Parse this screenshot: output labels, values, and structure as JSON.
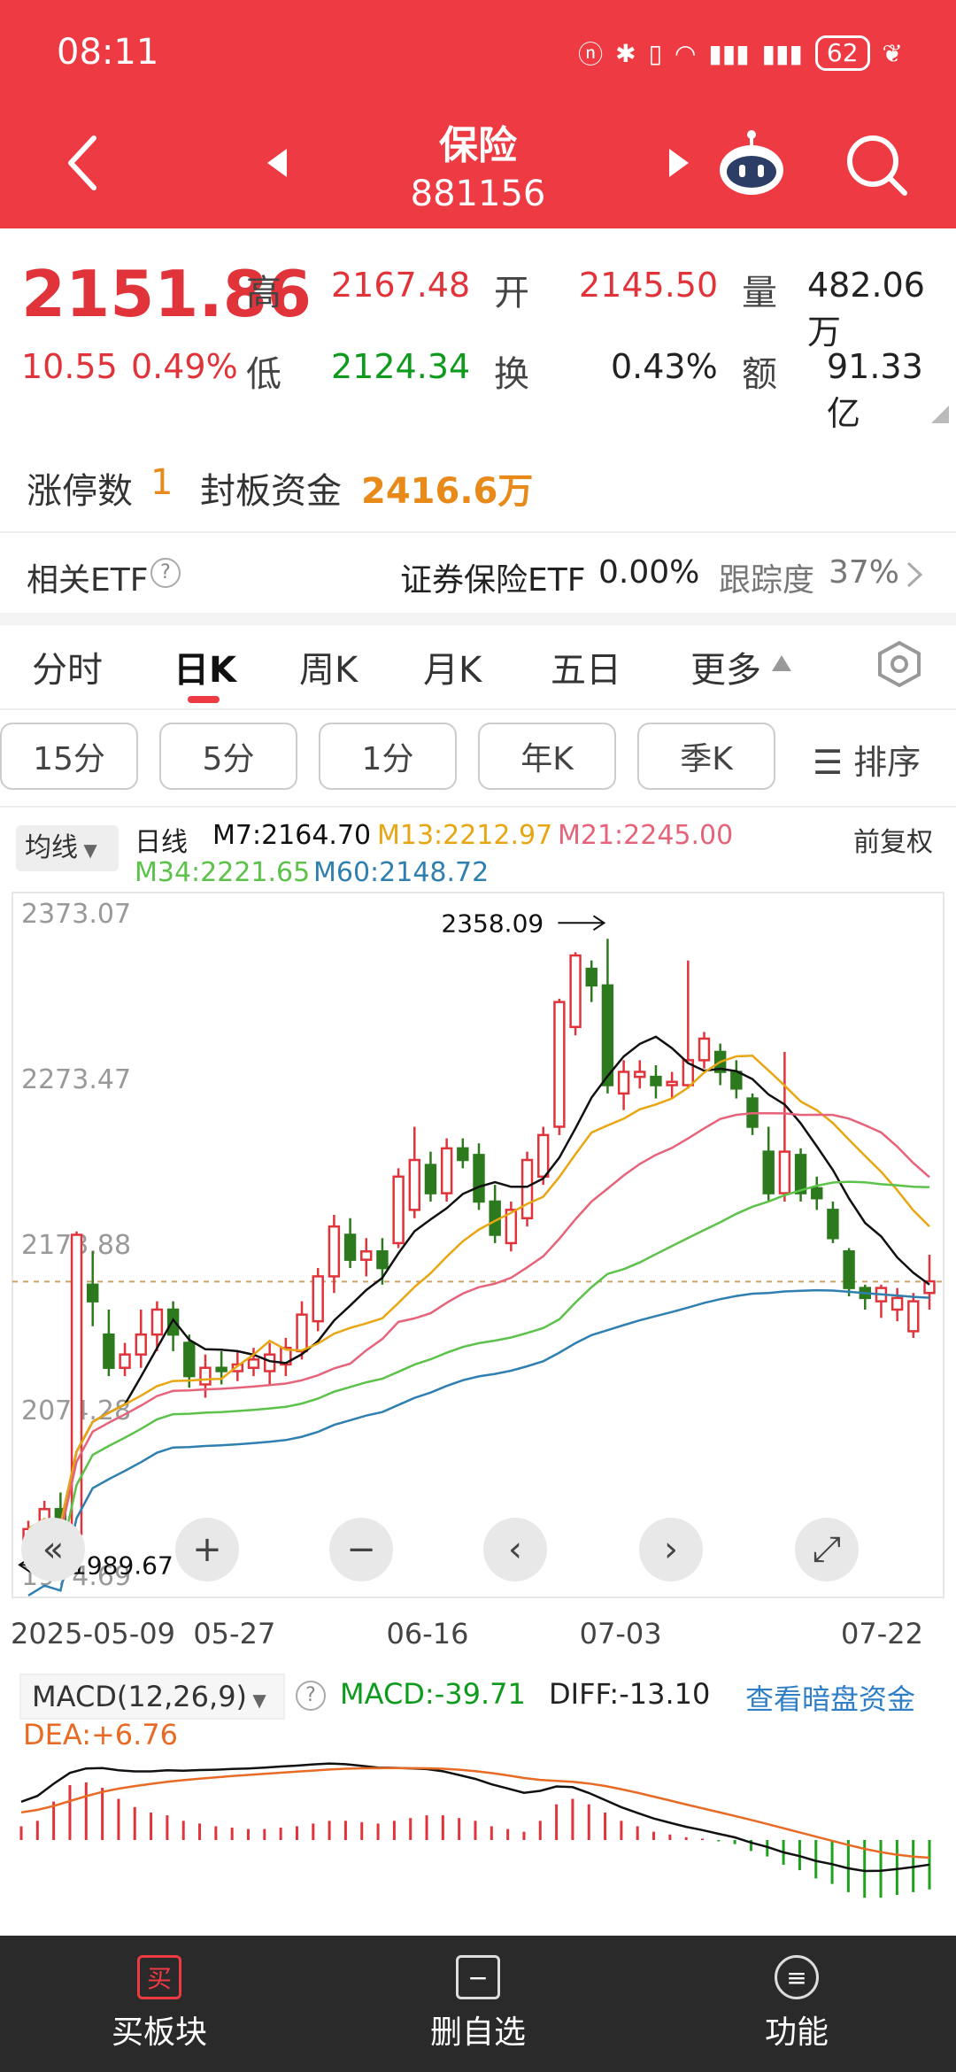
{
  "status": {
    "time": "08:11",
    "battery": "62"
  },
  "header": {
    "title": "保险",
    "code": "881156"
  },
  "quote": {
    "price": "2151.86",
    "change": "10.55",
    "change_pct": "0.49%",
    "high_label": "高",
    "high": "2167.48",
    "open_label": "开",
    "open": "2145.50",
    "vol_label": "量",
    "vol": "482.06万",
    "low_label": "低",
    "low": "2124.34",
    "turnover_label": "换",
    "turnover": "0.43%",
    "amount_label": "额",
    "amount": "91.33亿"
  },
  "limit": {
    "count_label": "涨停数",
    "count": "1",
    "fund_label": "封板资金",
    "fund": "2416.6万"
  },
  "etf": {
    "label": "相关ETF",
    "name": "证券保险ETF",
    "value": "0.00%",
    "track_label": "跟踪度",
    "track": "37%"
  },
  "tabs": [
    "分时",
    "日K",
    "周K",
    "月K",
    "五日",
    "更多"
  ],
  "periods": [
    "15分",
    "5分",
    "1分",
    "年K",
    "季K"
  ],
  "sort_label": "排序",
  "ma_dropdown": "均线",
  "legend": {
    "period": "日线",
    "m7": "M7:2164.70",
    "m13": "M13:2212.97",
    "m21": "M21:2245.00",
    "m34": "M34:2221.65",
    "m60": "M60:2148.72",
    "adjust": "前复权"
  },
  "colors": {
    "accent": "#ee3a42",
    "up": "#e0333a",
    "down": "#2d7a1e",
    "m7": "#111111",
    "m13": "#e8a612",
    "m21": "#e6647a",
    "m34": "#5cc24a",
    "m60": "#2f7fb0"
  },
  "chart_data": {
    "type": "candlestick",
    "y_ticks": [
      "2373.07",
      "2273.47",
      "2173.88",
      "2074.28",
      "1974.69"
    ],
    "ylim": [
      1974.69,
      2373.07
    ],
    "x_ticks": [
      "2025-05-09",
      "05-27",
      "06-16",
      "07-03",
      "07-22"
    ],
    "high_mark": "2358.09",
    "low_mark": "1989.67",
    "candles": [
      [
        1995,
        2003,
        1990,
        2008
      ],
      [
        2003,
        2015,
        1998,
        2020
      ],
      [
        2015,
        2000,
        1995,
        2025
      ],
      [
        2000,
        2180,
        1995,
        2182
      ],
      [
        2150,
        2140,
        2125,
        2170
      ],
      [
        2120,
        2100,
        2095,
        2135
      ],
      [
        2100,
        2108,
        2095,
        2115
      ],
      [
        2108,
        2120,
        2100,
        2135
      ],
      [
        2120,
        2135,
        2110,
        2140
      ],
      [
        2135,
        2120,
        2110,
        2140
      ],
      [
        2115,
        2095,
        2088,
        2120
      ],
      [
        2090,
        2100,
        2082,
        2108
      ],
      [
        2100,
        2098,
        2090,
        2110
      ],
      [
        2098,
        2102,
        2092,
        2110
      ],
      [
        2100,
        2105,
        2095,
        2112
      ],
      [
        2098,
        2108,
        2090,
        2115
      ],
      [
        2102,
        2112,
        2095,
        2118
      ],
      [
        2110,
        2132,
        2105,
        2140
      ],
      [
        2128,
        2155,
        2122,
        2160
      ],
      [
        2155,
        2185,
        2145,
        2192
      ],
      [
        2180,
        2165,
        2160,
        2190
      ],
      [
        2165,
        2170,
        2155,
        2178
      ],
      [
        2170,
        2160,
        2150,
        2178
      ],
      [
        2175,
        2215,
        2172,
        2220
      ],
      [
        2195,
        2225,
        2190,
        2245
      ],
      [
        2222,
        2205,
        2200,
        2230
      ],
      [
        2205,
        2232,
        2200,
        2238
      ],
      [
        2232,
        2225,
        2220,
        2238
      ],
      [
        2228,
        2200,
        2195,
        2235
      ],
      [
        2200,
        2180,
        2175,
        2210
      ],
      [
        2175,
        2195,
        2170,
        2200
      ],
      [
        2190,
        2225,
        2185,
        2230
      ],
      [
        2215,
        2240,
        2210,
        2245
      ],
      [
        2245,
        2320,
        2240,
        2322
      ],
      [
        2305,
        2348,
        2300,
        2350
      ],
      [
        2340,
        2330,
        2320,
        2345
      ],
      [
        2330,
        2270,
        2265,
        2358
      ],
      [
        2265,
        2278,
        2255,
        2285
      ],
      [
        2275,
        2278,
        2268,
        2285
      ],
      [
        2275,
        2270,
        2262,
        2282
      ],
      [
        2270,
        2272,
        2262,
        2278
      ],
      [
        2270,
        2285,
        2268,
        2345
      ],
      [
        2285,
        2298,
        2280,
        2302
      ],
      [
        2290,
        2278,
        2270,
        2295
      ],
      [
        2278,
        2268,
        2262,
        2285
      ],
      [
        2262,
        2245,
        2240,
        2265
      ],
      [
        2230,
        2205,
        2200,
        2245
      ],
      [
        2205,
        2230,
        2200,
        2290
      ],
      [
        2228,
        2205,
        2200,
        2232
      ],
      [
        2208,
        2202,
        2195,
        2215
      ],
      [
        2195,
        2178,
        2175,
        2200
      ],
      [
        2170,
        2148,
        2143,
        2172
      ],
      [
        2148,
        2142,
        2135,
        2150
      ],
      [
        2140,
        2148,
        2130,
        2150
      ],
      [
        2135,
        2142,
        2128,
        2148
      ],
      [
        2122,
        2140,
        2118,
        2145
      ],
      [
        2145,
        2152,
        2135,
        2168
      ]
    ]
  },
  "macd": {
    "label": "MACD(12,26,9)",
    "macd": "MACD:-39.71",
    "diff": "DIFF:-13.10",
    "dea": "DEA:+6.76",
    "link": "查看暗盘资金",
    "bars": [
      10,
      14,
      28,
      40,
      42,
      38,
      30,
      24,
      20,
      18,
      14,
      12,
      10,
      9,
      8,
      8,
      9,
      10,
      12,
      14,
      14,
      13,
      12,
      14,
      16,
      18,
      18,
      16,
      14,
      10,
      8,
      6,
      14,
      26,
      30,
      26,
      20,
      14,
      10,
      6,
      4,
      2,
      1,
      -1,
      -3,
      -8,
      -12,
      -18,
      -22,
      -28,
      -32,
      -38,
      -42,
      -42,
      -40,
      -38,
      -36
    ]
  },
  "bottom": {
    "buy": "买板块",
    "buy_icon": "买",
    "delete": "删自选",
    "func": "功能"
  }
}
